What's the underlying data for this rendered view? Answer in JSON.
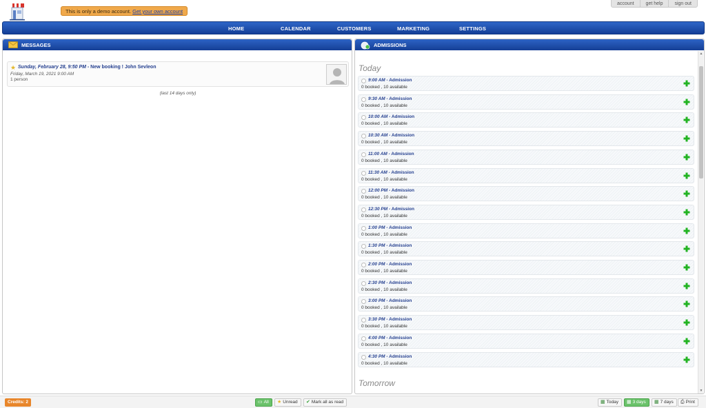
{
  "header": {
    "logo_icon": "storefront-logo-icon",
    "demo_text": "This is only a demo account.",
    "demo_link": "Get your own account",
    "top_links": [
      "account",
      "get help",
      "sign out"
    ]
  },
  "nav": {
    "items": [
      "HOME",
      "CALENDAR",
      "CUSTOMERS",
      "MARKETING",
      "SETTINGS"
    ]
  },
  "messages": {
    "title": "MESSAGES",
    "icon": "envelope-icon",
    "items": [
      {
        "datetime": "Sunday, February 28, 9:50 PM",
        "text": "- New booking ! John Sevleon",
        "date": "Friday, March 19, 2021 9:00 AM",
        "persons": "1 person",
        "avatar": "user-avatar-icon"
      }
    ],
    "note": "(last 14 days only)"
  },
  "admissions": {
    "title": "ADMISSIONS",
    "icon": "admissions-icon",
    "today_label": "Today",
    "tomorrow_label": "Tomorrow",
    "slots": [
      {
        "time": "9:00 AM",
        "name": "- Admission",
        "booked": "0 booked , 10 available"
      },
      {
        "time": "9:30 AM",
        "name": "- Admission",
        "booked": "0 booked , 10 available"
      },
      {
        "time": "10:00 AM",
        "name": "- Admission",
        "booked": "0 booked , 10 available"
      },
      {
        "time": "10:30 AM",
        "name": "- Admission",
        "booked": "0 booked , 10 available"
      },
      {
        "time": "11:00 AM",
        "name": "- Admission",
        "booked": "0 booked , 10 available"
      },
      {
        "time": "11:30 AM",
        "name": "- Admission",
        "booked": "0 booked , 10 available"
      },
      {
        "time": "12:00 PM",
        "name": "- Admission",
        "booked": "0 booked , 10 available"
      },
      {
        "time": "12:30 PM",
        "name": "- Admission",
        "booked": "0 booked , 10 available"
      },
      {
        "time": "1:00 PM",
        "name": "- Admission",
        "booked": "0 booked , 10 available"
      },
      {
        "time": "1:30 PM",
        "name": "- Admission",
        "booked": "0 booked , 10 available"
      },
      {
        "time": "2:00 PM",
        "name": "- Admission",
        "booked": "0 booked , 10 available"
      },
      {
        "time": "2:30 PM",
        "name": "- Admission",
        "booked": "0 booked , 10 available"
      },
      {
        "time": "3:00 PM",
        "name": "- Admission",
        "booked": "0 booked , 10 available"
      },
      {
        "time": "3:30 PM",
        "name": "- Admission",
        "booked": "0 booked , 10 available"
      },
      {
        "time": "4:00 PM",
        "name": "- Admission",
        "booked": "0 booked , 10 available"
      },
      {
        "time": "4:30 PM",
        "name": "- Admission",
        "booked": "0 booked , 10 available"
      }
    ]
  },
  "footer": {
    "credits": "Credits: 2",
    "filters": [
      {
        "label": "All",
        "icon": "inbox-icon",
        "active": true
      },
      {
        "label": "Unread",
        "icon": "star-icon",
        "active": false
      },
      {
        "label": "Mark all as read",
        "icon": "checkmark-icon",
        "active": false
      }
    ],
    "views": [
      {
        "label": "Today",
        "icon": "calendar-icon",
        "active": false
      },
      {
        "label": "3 days",
        "icon": "calendar-icon",
        "active": true
      },
      {
        "label": "7 days",
        "icon": "calendar-icon",
        "active": false
      },
      {
        "label": "Print",
        "icon": "printer-icon",
        "active": false
      }
    ]
  },
  "colors": {
    "nav_blue": "#1f4fae",
    "demo_orange": "#f0a94b",
    "add_green": "#22b322",
    "credits_orange": "#e8862b",
    "active_green": "#6bc26b"
  }
}
